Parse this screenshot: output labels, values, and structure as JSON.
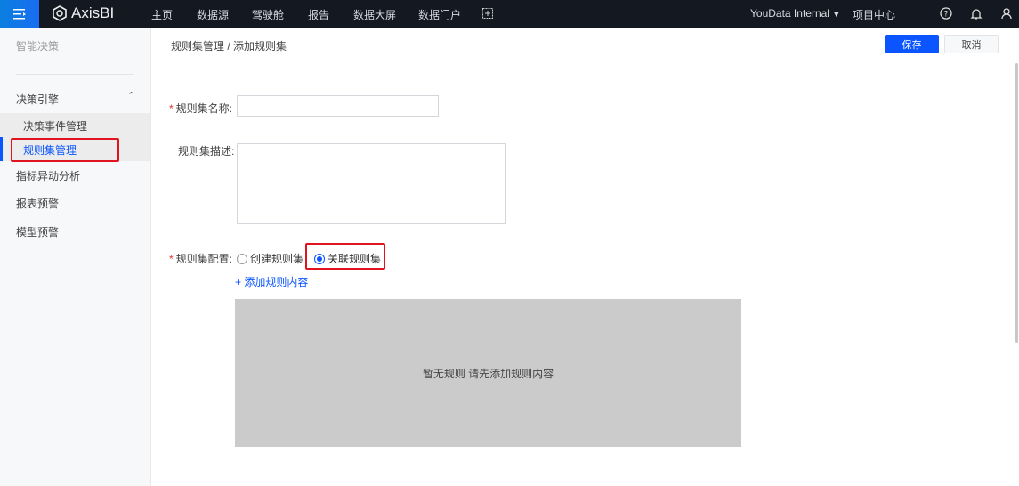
{
  "topbar": {
    "brand": "AxisBI",
    "nav": [
      "主页",
      "数据源",
      "驾驶舱",
      "报告",
      "数据大屏",
      "数据门户"
    ],
    "workspace": "YouData Internal",
    "project_center": "项目中心"
  },
  "sidebar": {
    "title": "智能决策",
    "group": "决策引擎",
    "subitems": [
      "决策事件管理",
      "规则集管理"
    ],
    "items": [
      "指标异动分析",
      "报表预警",
      "模型预警"
    ]
  },
  "header": {
    "breadcrumb": "规则集管理 / 添加规则集",
    "save": "保存",
    "cancel": "取消"
  },
  "form": {
    "name_label": "规则集名称:",
    "name_value": "",
    "desc_label": "规则集描述:",
    "desc_value": "",
    "config_label": "规则集配置:",
    "options": [
      "创建规则集",
      "关联规则集"
    ],
    "selected": "关联规则集",
    "add_rule": "+ 添加规则内容",
    "empty": "暂无规则 请先添加规则内容"
  },
  "colors": {
    "accent": "#0a55ff",
    "highlight": "#e0141e",
    "topbar": "#141821"
  }
}
